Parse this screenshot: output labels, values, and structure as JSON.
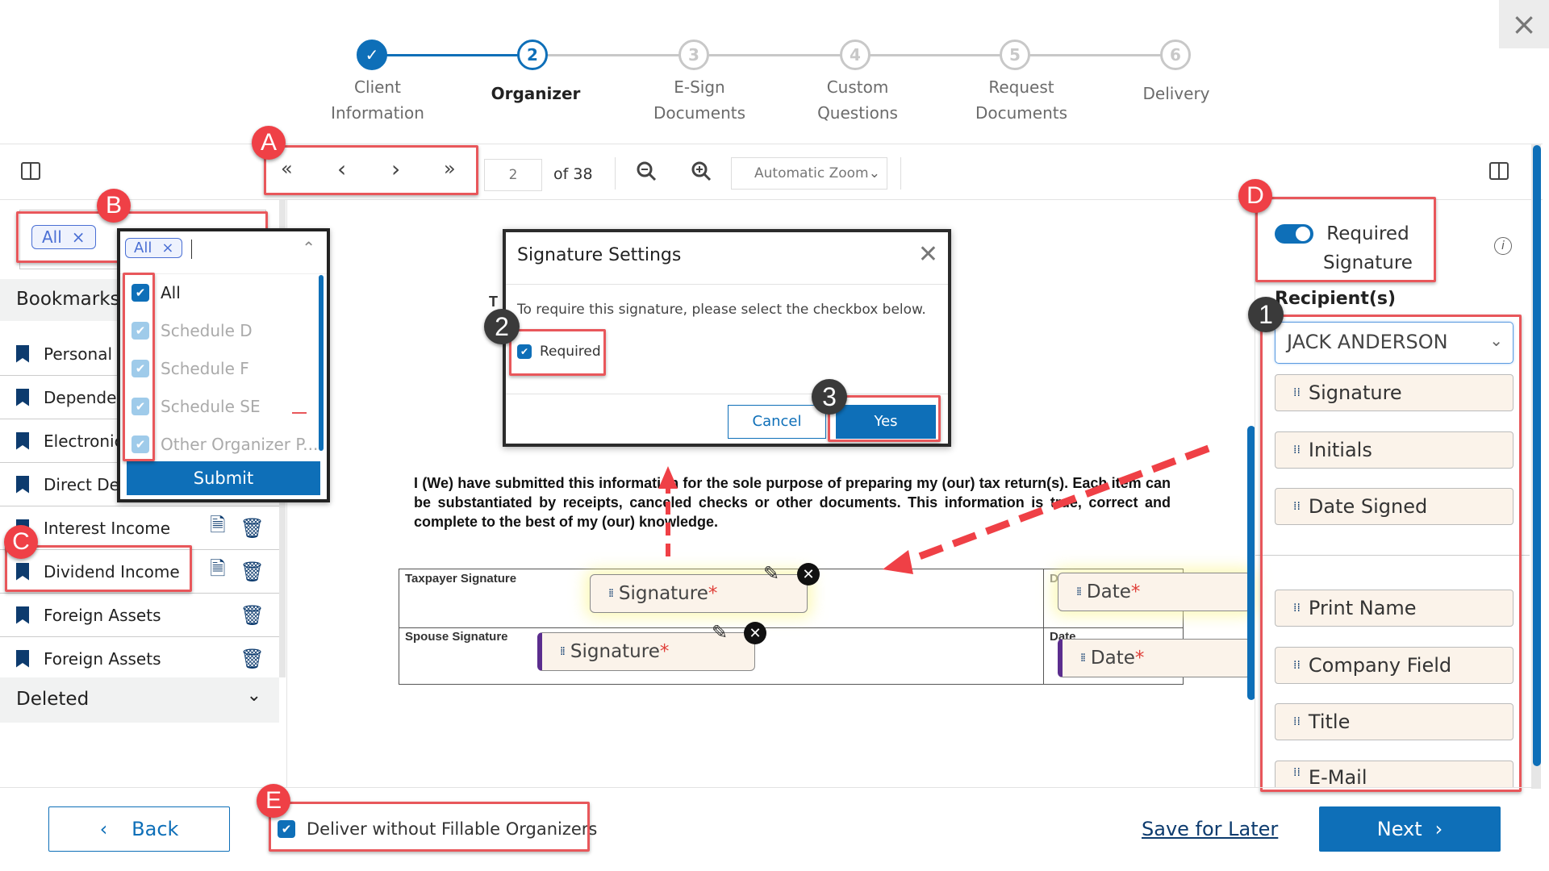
{
  "stepper": {
    "steps": [
      {
        "number": "✓",
        "label_line1": "Client",
        "label_line2": "Information",
        "state": "done"
      },
      {
        "number": "2",
        "label_line1": "Organizer",
        "label_line2": "",
        "state": "active"
      },
      {
        "number": "3",
        "label_line1": "E-Sign",
        "label_line2": "Documents",
        "state": "pending"
      },
      {
        "number": "4",
        "label_line1": "Custom",
        "label_line2": "Questions",
        "state": "pending"
      },
      {
        "number": "5",
        "label_line1": "Request",
        "label_line2": "Documents",
        "state": "pending"
      },
      {
        "number": "6",
        "label_line1": "Delivery",
        "label_line2": "",
        "state": "pending"
      }
    ]
  },
  "window": {
    "close_icon": "×"
  },
  "toolbar": {
    "first_page": "«",
    "prev_page": "‹",
    "next_page": "›",
    "last_page": "»",
    "current_page": "2",
    "total_pages_label": "of 38",
    "zoom_out": "zoom-out",
    "zoom_in": "zoom-in",
    "zoom_level": "Automatic Zoom"
  },
  "annotations": {
    "A": "A",
    "B": "B",
    "C": "C",
    "D": "D",
    "E": "E",
    "step1": "1",
    "step2": "2",
    "step3": "3"
  },
  "filter": {
    "chip_label": "All",
    "chip_remove": "×",
    "dropdown_chip": "All",
    "options": [
      {
        "label": "All",
        "checked": true
      },
      {
        "label": "Schedule D",
        "checked": true
      },
      {
        "label": "Schedule F",
        "checked": true
      },
      {
        "label": "Schedule SE",
        "checked": true
      },
      {
        "label": "Other Organizer P...",
        "checked": true
      }
    ],
    "submit_label": "Submit"
  },
  "bookmarks": {
    "header": "Bookmarks",
    "items": [
      {
        "label": "Personal"
      },
      {
        "label": "Dependents"
      },
      {
        "label": "Electronic"
      },
      {
        "label": "Direct Deposit"
      },
      {
        "label": "Interest Income"
      },
      {
        "label": "Dividend Income"
      },
      {
        "label": "Foreign Assets"
      },
      {
        "label": "Foreign Assets"
      }
    ],
    "deleted_label": "Deleted"
  },
  "modal": {
    "title": "Signature Settings",
    "message": "To require this signature, please select the checkbox below.",
    "checkbox_label": "Required",
    "checkbox_checked": true,
    "cancel_label": "Cancel",
    "yes_label": "Yes"
  },
  "document": {
    "partial_letter": "T",
    "paragraph": "I (We) have submitted this information for the sole purpose of preparing my (our) tax return(s). Each item can be substantiated by receipts, canceled checks or other documents. This information is true, correct and complete to the best of my (our) knowledge.",
    "taxpayer_label": "Taxpayer Signature",
    "spouse_label": "Spouse Signature",
    "date_label": "Date",
    "date_label_partial": "D",
    "signature_field": "Signature",
    "date_field": "Date",
    "required_mark": "*"
  },
  "right_panel": {
    "toggle_on": true,
    "toggle_label_line1": "Required",
    "toggle_label_line2": "Signature",
    "recipients_label": "Recipient(s)",
    "recipient_selected": "JACK ANDERSON",
    "fields_group1": [
      "Signature",
      "Initials",
      "Date Signed"
    ],
    "fields_group2": [
      "Print Name",
      "Company Field",
      "Title",
      "E-Mail"
    ]
  },
  "footer": {
    "back_label": "Back",
    "deliver_label": "Deliver without Fillable Organizers",
    "deliver_checked": true,
    "save_later_label": "Save for Later",
    "next_label": "Next"
  },
  "colors": {
    "primary": "#0e6fb8",
    "annotation_red": "#ef4046",
    "field_bg": "#fbf3ea",
    "bookmark_navy": "#0d3b6e"
  }
}
